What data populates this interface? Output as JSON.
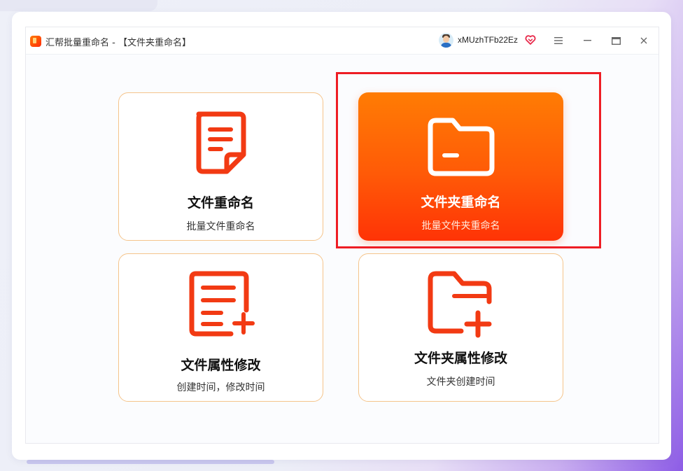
{
  "window": {
    "app_title": "汇帮批量重命名 - 【文件夹重命名】",
    "username": "xMUzhTFb22Ez"
  },
  "cards": [
    {
      "title": "文件重命名",
      "subtitle": "批量文件重命名",
      "icon": "document-icon"
    },
    {
      "title": "文件夹重命名",
      "subtitle": "批量文件夹重命名",
      "icon": "folder-icon",
      "selected": true
    },
    {
      "title": "文件属性修改",
      "subtitle": "创建时间，修改时间",
      "icon": "document-add-icon"
    },
    {
      "title": "文件夹属性修改",
      "subtitle": "文件夹创建时间",
      "icon": "folder-add-icon"
    }
  ],
  "colors": {
    "accent": "#ff5a07",
    "icon_red": "#f23a13",
    "card_border": "#f5c48b",
    "highlight_box": "#ee1d24"
  }
}
